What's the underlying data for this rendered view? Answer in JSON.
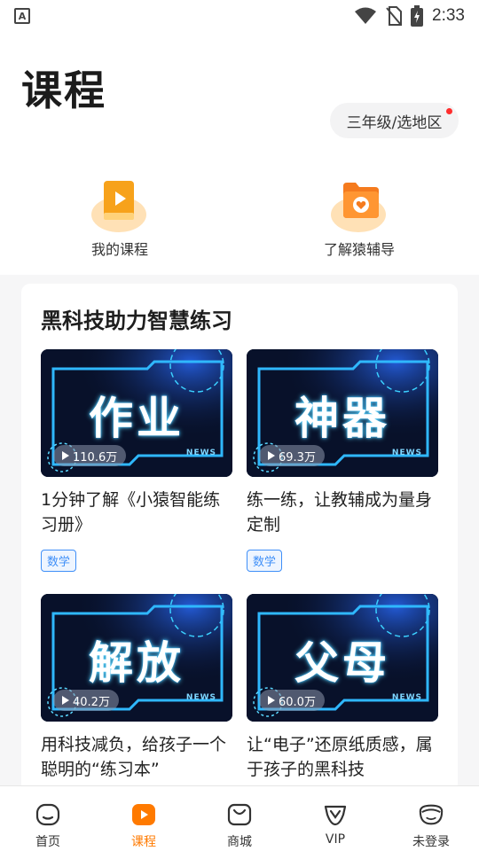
{
  "status_bar": {
    "time": "2:33",
    "app_badge": "A"
  },
  "header": {
    "title": "课程",
    "grade_selector": "三年级/选地区"
  },
  "shortcuts": [
    {
      "label": "我的课程",
      "icon": "course-book-icon"
    },
    {
      "label": "了解猿辅导",
      "icon": "folder-heart-icon"
    }
  ],
  "section": {
    "title": "黑科技助力智慧练习",
    "cards": [
      {
        "thumb_text": "作业",
        "views": "110.6万",
        "badge": "NEWS",
        "title": "1分钟了解《小猿智能练习册》",
        "tag": "数学"
      },
      {
        "thumb_text": "神器",
        "views": "69.3万",
        "badge": "NEWS",
        "title": "练一练，让教辅成为量身定制",
        "tag": "数学"
      },
      {
        "thumb_text": "解放",
        "views": "40.2万",
        "badge": "NEWS",
        "title": "用科技减负，给孩子一个聪明的“练习本”",
        "tag": ""
      },
      {
        "thumb_text": "父母",
        "views": "60.0万",
        "badge": "NEWS",
        "title": "让“电子”还原纸质感，属于孩子的黑科技",
        "tag": ""
      }
    ]
  },
  "tabbar": {
    "tabs": [
      {
        "label": "首页",
        "icon": "home-icon",
        "active": false
      },
      {
        "label": "课程",
        "icon": "play-icon",
        "active": true
      },
      {
        "label": "商城",
        "icon": "shop-bag-icon",
        "active": false
      },
      {
        "label": "VIP",
        "icon": "vip-icon",
        "active": false
      },
      {
        "label": "未登录",
        "icon": "profile-face-icon",
        "active": false
      }
    ]
  },
  "colors": {
    "accent": "#ff7a00",
    "tag_blue": "#3f8ff8",
    "notification_dot": "#ff2d2d"
  }
}
